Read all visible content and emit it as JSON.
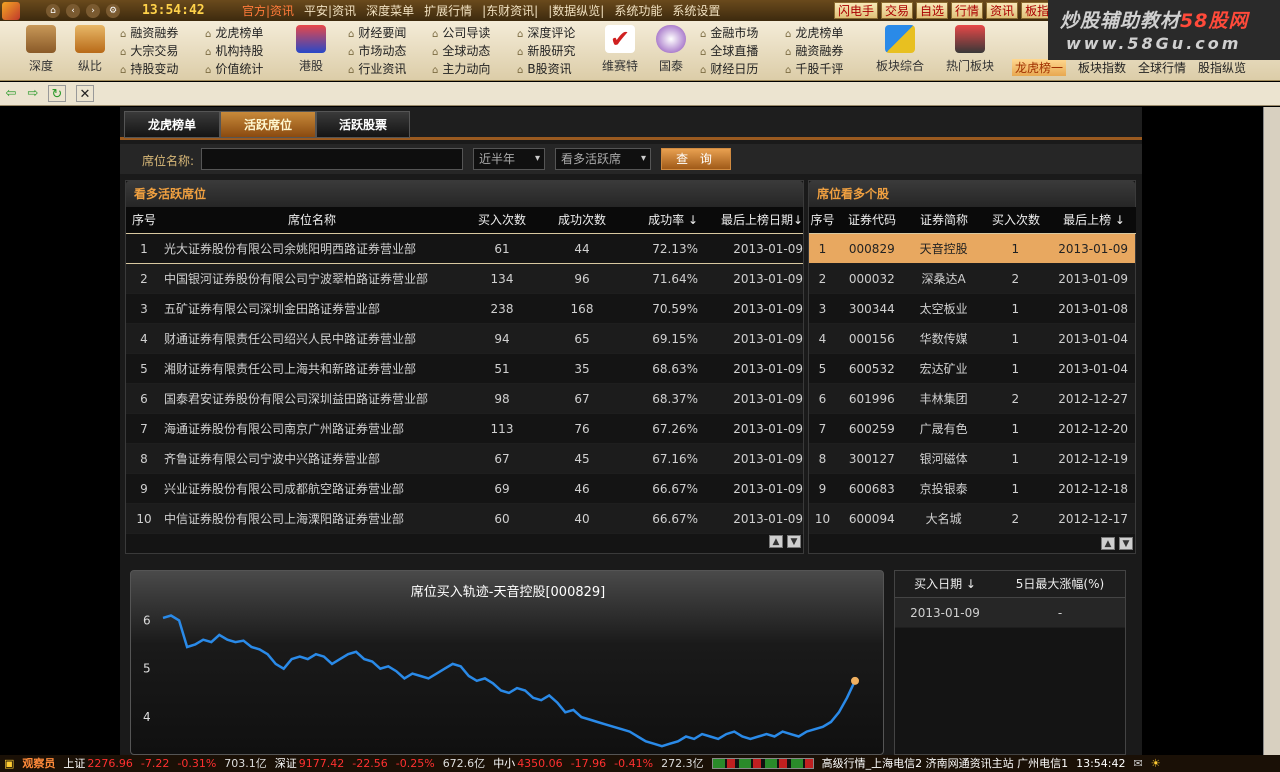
{
  "menubar": {
    "clock": "13:54:42",
    "items": [
      "官方|资讯",
      "平安|资讯",
      "深度菜单",
      "扩展行情",
      "|东财资讯|",
      "|数据纵览|",
      "系统功能",
      "系统设置"
    ],
    "right_buttons": [
      "闪电手",
      "交易",
      "自选",
      "行情",
      "资讯",
      "板指"
    ]
  },
  "brand": {
    "line1_a": "炒股辅助教材",
    "line1_b": "58股网",
    "line2": "www.58Gu.com"
  },
  "toolbar": {
    "big": [
      "深度",
      "纵比",
      "港股",
      "维赛特",
      "国泰",
      "板块综合",
      "热门板块"
    ],
    "groups": [
      [
        "融资融券",
        "大宗交易",
        "持股变动"
      ],
      [
        "龙虎榜单",
        "机构持股",
        "价值统计"
      ],
      [
        "财经要闻",
        "市场动态",
        "行业资讯"
      ],
      [
        "公司导读",
        "全球动态",
        "主力动向"
      ],
      [
        "深度评论",
        "新股研究",
        "B股资讯"
      ],
      [
        "金融市场",
        "全球直播",
        "财经日历"
      ],
      [
        "龙虎榜单",
        "融资融券",
        "千股千评"
      ]
    ],
    "right": [
      "龙虎榜一",
      "板块指数",
      "全球行情",
      "股指纵览"
    ]
  },
  "tabs": [
    "龙虎榜单",
    "活跃席位",
    "活跃股票"
  ],
  "filter": {
    "label": "席位名称:",
    "input_value": "",
    "period": "近半年",
    "mode": "看多活跃席",
    "button": "查 询"
  },
  "left_table": {
    "title": "看多活跃席位",
    "headers": [
      "序号",
      "席位名称",
      "买入次数",
      "成功次数",
      "成功率 ↓",
      "最后上榜日期↓"
    ],
    "rows": [
      [
        "1",
        "光大证券股份有限公司余姚阳明西路证券营业部",
        "61",
        "44",
        "72.13%",
        "2013-01-09"
      ],
      [
        "2",
        "中国银河证券股份有限公司宁波翠柏路证券营业部",
        "134",
        "96",
        "71.64%",
        "2013-01-09"
      ],
      [
        "3",
        "五矿证券有限公司深圳金田路证券营业部",
        "238",
        "168",
        "70.59%",
        "2013-01-09"
      ],
      [
        "4",
        "财通证券有限责任公司绍兴人民中路证券营业部",
        "94",
        "65",
        "69.15%",
        "2013-01-09"
      ],
      [
        "5",
        "湘财证券有限责任公司上海共和新路证券营业部",
        "51",
        "35",
        "68.63%",
        "2013-01-09"
      ],
      [
        "6",
        "国泰君安证券股份有限公司深圳益田路证券营业部",
        "98",
        "67",
        "68.37%",
        "2013-01-09"
      ],
      [
        "7",
        "海通证券股份有限公司南京广州路证券营业部",
        "113",
        "76",
        "67.26%",
        "2013-01-09"
      ],
      [
        "8",
        "齐鲁证券有限公司宁波中兴路证券营业部",
        "67",
        "45",
        "67.16%",
        "2013-01-09"
      ],
      [
        "9",
        "兴业证券股份有限公司成都航空路证券营业部",
        "69",
        "46",
        "66.67%",
        "2013-01-09"
      ],
      [
        "10",
        "中信证券股份有限公司上海溧阳路证券营业部",
        "60",
        "40",
        "66.67%",
        "2013-01-09"
      ]
    ]
  },
  "right_table": {
    "title": "席位看多个股",
    "headers": [
      "序号",
      "证券代码",
      "证券简称",
      "买入次数",
      "最后上榜 ↓"
    ],
    "rows": [
      [
        "1",
        "000829",
        "天音控股",
        "1",
        "2013-01-09"
      ],
      [
        "2",
        "000032",
        "深桑达A",
        "2",
        "2013-01-09"
      ],
      [
        "3",
        "300344",
        "太空板业",
        "1",
        "2013-01-08"
      ],
      [
        "4",
        "000156",
        "华数传媒",
        "1",
        "2013-01-04"
      ],
      [
        "5",
        "600532",
        "宏达矿业",
        "1",
        "2013-01-04"
      ],
      [
        "6",
        "601996",
        "丰林集团",
        "2",
        "2012-12-27"
      ],
      [
        "7",
        "600259",
        "广晟有色",
        "1",
        "2012-12-20"
      ],
      [
        "8",
        "300127",
        "银河磁体",
        "1",
        "2012-12-19"
      ],
      [
        "9",
        "600683",
        "京投银泰",
        "1",
        "2012-12-18"
      ],
      [
        "10",
        "600094",
        "大名城",
        "2",
        "2012-12-17"
      ]
    ]
  },
  "chart_data": {
    "type": "line",
    "title": "席位买入轨迹-天音控股[000829]",
    "xlabel": "",
    "ylabel": "",
    "y_ticks": [
      6,
      5,
      4
    ],
    "ylim": [
      3.3,
      6.4
    ],
    "values": [
      6.05,
      6.1,
      6.0,
      5.45,
      5.5,
      5.6,
      5.55,
      5.7,
      5.6,
      5.55,
      5.58,
      5.45,
      5.4,
      5.3,
      5.1,
      5.0,
      5.2,
      5.25,
      5.2,
      5.3,
      5.25,
      5.1,
      5.2,
      5.3,
      5.35,
      5.2,
      5.15,
      5.0,
      5.05,
      4.95,
      4.8,
      4.9,
      4.85,
      4.8,
      4.9,
      5.0,
      5.1,
      5.05,
      4.85,
      4.75,
      4.8,
      4.7,
      4.55,
      4.5,
      4.6,
      4.55,
      4.4,
      4.35,
      4.45,
      4.3,
      4.1,
      4.15,
      4.0,
      3.95,
      3.9,
      3.85,
      3.8,
      3.75,
      3.7,
      3.6,
      3.5,
      3.45,
      3.4,
      3.45,
      3.5,
      3.6,
      3.55,
      3.65,
      3.6,
      3.55,
      3.65,
      3.7,
      3.6,
      3.55,
      3.6,
      3.65,
      3.6,
      3.7,
      3.65,
      3.6,
      3.7,
      3.75,
      3.8,
      3.9,
      4.1,
      4.4,
      4.75
    ],
    "marker": {
      "index": 86,
      "value": 4.75,
      "color": "#f0b060"
    },
    "line_color": "#2a8ae8",
    "grid": false
  },
  "side_table": {
    "headers": [
      "买入日期 ↓",
      "5日最大涨幅(%)"
    ],
    "rows": [
      [
        "2013-01-09",
        "-"
      ]
    ]
  },
  "statusbar": {
    "badge": "观察员",
    "sh": "上证",
    "sh_idx": "2276.96",
    "sh_chg": "-7.22",
    "sh_pct": "-0.31%",
    "sh_amt": "703.1亿",
    "sz": "深证",
    "sz_idx": "9177.42",
    "sz_chg": "-22.56",
    "sz_pct": "-0.25%",
    "sz_amt": "672.6亿",
    "zx": "中小",
    "zx_idx": "4350.06",
    "zx_chg": "-17.96",
    "zx_pct": "-0.41%",
    "zx_amt": "272.3亿",
    "servers": "高级行情_上海电信2  济南网通资讯主站  广州电信1",
    "time": "13:54:42"
  }
}
